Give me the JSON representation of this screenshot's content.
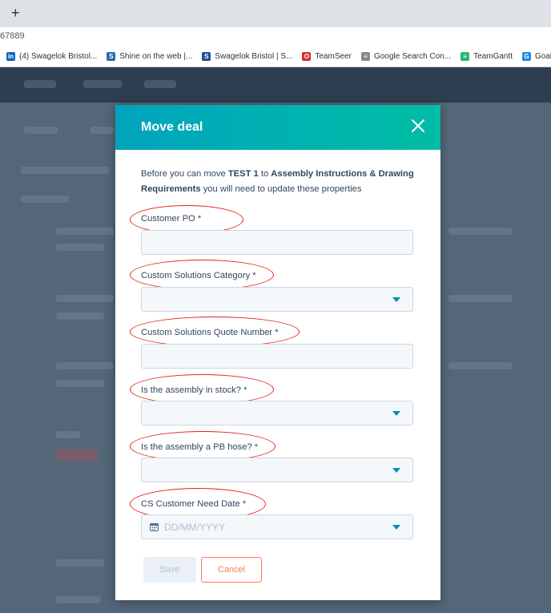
{
  "browser": {
    "new_tab": "+",
    "url_fragment": "67889",
    "bookmarks": [
      {
        "label": "(4) Swagelok Bristol...",
        "icon": "linkedin-icon",
        "color": "#0a66c2",
        "glyph": "in"
      },
      {
        "label": "Shine on the web |...",
        "icon": "shine-icon",
        "color": "#2b6cb0",
        "glyph": "S"
      },
      {
        "label": "Swagelok Bristol | S...",
        "icon": "swagelok-icon",
        "color": "#1f4e9a",
        "glyph": "S"
      },
      {
        "label": "TeamSeer",
        "icon": "teamseer-icon",
        "color": "#d32f2f",
        "glyph": "O"
      },
      {
        "label": "Google Search Con...",
        "icon": "google-search-console-icon",
        "color": "#888888",
        "glyph": "≡"
      },
      {
        "label": "TeamGantt",
        "icon": "teamgantt-icon",
        "color": "#2bb673",
        "glyph": "≡"
      },
      {
        "label": "Goalscape Online",
        "icon": "goalscape-icon",
        "color": "#1e88e5",
        "glyph": "G"
      }
    ]
  },
  "modal": {
    "title": "Move deal",
    "intro_before": "Before you can move ",
    "deal_name": "TEST 1",
    "intro_mid": " to ",
    "stage_name": "Assembly Instructions & Drawing Requirements",
    "intro_after": " you will need to update these properties",
    "fields": [
      {
        "label": "Customer PO *",
        "type": "text",
        "value": ""
      },
      {
        "label": "Custom Solutions Category *",
        "type": "select",
        "value": ""
      },
      {
        "label": "Custom Solutions Quote Number *",
        "type": "text",
        "value": ""
      },
      {
        "label": "Is the assembly in stock? *",
        "type": "select",
        "value": ""
      },
      {
        "label": "Is the assembly a PB hose? *",
        "type": "select",
        "value": ""
      },
      {
        "label": "CS Customer Need Date *",
        "type": "date",
        "placeholder": "DD/MM/YYYY"
      }
    ],
    "save_label": "Save",
    "cancel_label": "Cancel"
  },
  "colors": {
    "header_gradient_start": "#00a4bd",
    "header_gradient_end": "#00bda5",
    "accent_orange": "#ff7a59",
    "annotation_red": "#e0241b",
    "caret_teal": "#0091ae"
  }
}
